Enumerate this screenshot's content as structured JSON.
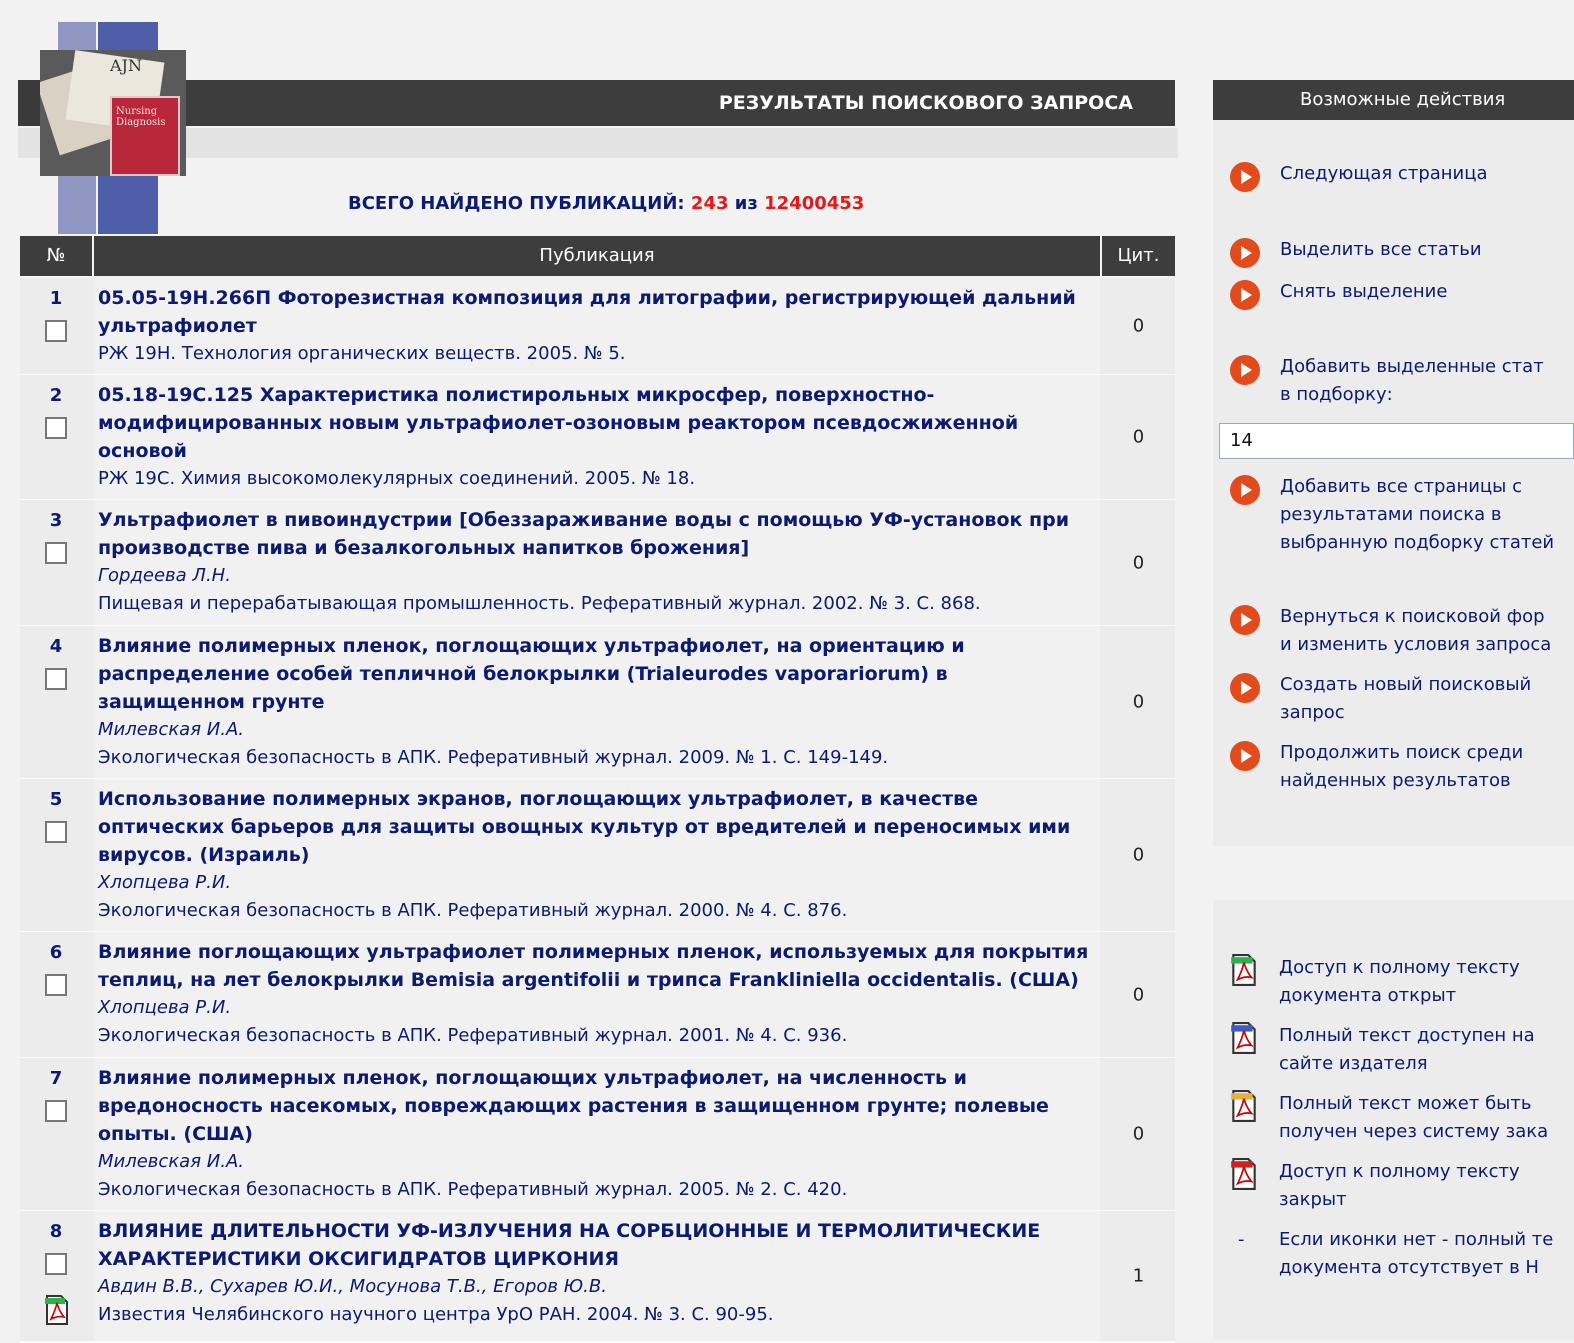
{
  "header": {
    "title": "РЕЗУЛЬТАТЫ ПОИСКОВОГО ЗАПРОСА",
    "found_label": "ВСЕГО НАЙДЕНО ПУБЛИКАЦИЙ:",
    "found_count": "243",
    "found_of": "из",
    "found_total": "12400453"
  },
  "table": {
    "columns": [
      "№",
      "Публикация",
      "Цит."
    ],
    "rows": [
      {
        "num": "1",
        "title": "05.05-19Н.266П Фоторезистная композиция для литографии, регистрирующей дальний ультрафиолет",
        "authors": "",
        "source": "РЖ 19Н. Технология органических веществ. 2005. № 5.",
        "cit": "0"
      },
      {
        "num": "2",
        "title": "05.18-19С.125 Характеристика полистирольных микросфер, поверхностно-модифицированных новым ультрафиолет-озоновым реактором псевдосжиженной основой",
        "authors": "",
        "source": "РЖ 19С. Химия высокомолекулярных соединений. 2005. № 18.",
        "cit": "0"
      },
      {
        "num": "3",
        "title": "Ультрафиолет в пивоиндустрии [Обеззараживание воды с помощью УФ-установок при производстве пива и безалкогольных напитков брожения]",
        "authors": "Гордеева Л.Н.",
        "source": "Пищевая и перерабатывающая промышленность. Реферативный журнал. 2002. № 3. С. 868.",
        "cit": "0"
      },
      {
        "num": "4",
        "title": "Влияние полимерных пленок, поглощающих ультрафиолет, на ориентацию и распределение особей тепличной белокрылки (Trialeurodes vaporariorum) в защищенном грунте",
        "authors": "Милевская И.А.",
        "source": "Экологическая безопасность в АПК. Реферативный журнал. 2009. № 1. С. 149-149.",
        "cit": "0"
      },
      {
        "num": "5",
        "title": "Использование полимерных экранов, поглощающих ультрафиолет, в качестве оптических барьеров для защиты овощных культур от вредителей и переносимых ими вирусов. (Израиль)",
        "authors": "Хлопцева Р.И.",
        "source": "Экологическая безопасность в АПК. Реферативный журнал. 2000. № 4. С. 876.",
        "cit": "0"
      },
      {
        "num": "6",
        "title": "Влияние поглощающих ультрафиолет полимерных пленок, используемых для покрытия теплиц, на лет белокрылки Bemisia argentifolii и трипса Frankliniella occidentalis. (США)",
        "authors": "Хлопцева Р.И.",
        "source": "Экологическая безопасность в АПК. Реферативный журнал. 2001. № 4. С. 936.",
        "cit": "0"
      },
      {
        "num": "7",
        "title": "Влияние полимерных пленок, поглощающих ультрафиолет, на численность и вредоносность насекомых, повреждающих растения в защищенном грунте; полевые опыты. (США)",
        "authors": "Милевская И.А.",
        "source": "Экологическая безопасность в АПК. Реферативный журнал. 2005. № 2. С. 420.",
        "cit": "0"
      },
      {
        "num": "8",
        "title": "ВЛИЯНИЕ ДЛИТЕЛЬНОСТИ УФ-ИЗЛУЧЕНИЯ НА СОРБЦИОННЫЕ И ТЕРМОЛИТИЧЕСКИЕ ХАРАКТЕРИСТИКИ ОКСИГИДРАТОВ ЦИРКОНИЯ",
        "authors": "Авдин В.В., Сухарев Ю.И., Мосунова Т.В., Егоров Ю.В.",
        "source": "Известия Челябинского научного центра УрО РАН. 2004. № 3. С. 90-95.",
        "cit": "1"
      }
    ]
  },
  "panel": {
    "title": "Возможные действия",
    "next_page": "Следующая страница",
    "select_all": "Выделить все статьи",
    "deselect": "Снять выделение",
    "add_selected_1": "Добавить выделенные стат",
    "add_selected_2": "в подборку:",
    "collection_value": "14",
    "add_all_1": "Добавить все страницы с",
    "add_all_2": "результатами поиска в",
    "add_all_3": "выбранную подборку статей",
    "back_1": "Вернуться к поисковой фор",
    "back_2": "и изменить условия запроса",
    "new_1": "Создать новый поисковый",
    "new_2": "запрос",
    "continue_1": "Продолжить поиск среди",
    "continue_2": "найденных результатов"
  },
  "legend": {
    "open_1": "Доступ к полному тексту",
    "open_2": "документа открыт",
    "publisher_1": "Полный текст доступен на",
    "publisher_2": "сайте издателя",
    "order_1": "Полный текст может быть",
    "order_2": "получен через систему зака",
    "closed_1": "Доступ к полному тексту",
    "closed_2": "закрыт",
    "none_dash": "-",
    "none_1": "Если иконки нет - полный те",
    "none_2": "документа отсутствует в Н"
  },
  "colors": {
    "header_bg": "#3d3d3d",
    "link": "#0b1b6f",
    "count_red": "#e01b1b",
    "action_arrow": "#e34a1c",
    "pdf_green": "#2bb24c",
    "pdf_blue": "#3b5bc8",
    "pdf_yellow": "#e8b23a",
    "pdf_red": "#d11f1f"
  }
}
